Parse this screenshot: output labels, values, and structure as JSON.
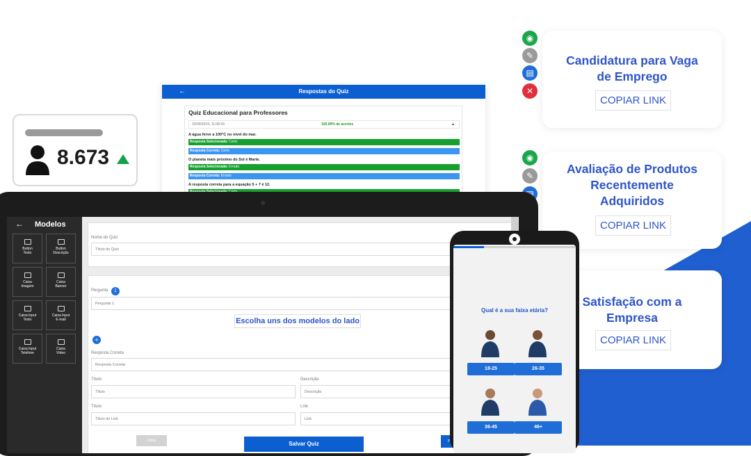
{
  "stat_card": {
    "value": "8.673",
    "trend": "up",
    "trend_color": "#15a04a"
  },
  "quiz_window": {
    "header": "Respostas do Quiz",
    "title": "Quiz Educacional para Professores",
    "timestamp": "25/09/2024, 11:08:43",
    "score": "100.00% de acertos",
    "questions": [
      {
        "text": "A água ferve a 100°C no nível do mar.",
        "selected_label": "Resposta Selecionada:",
        "selected": "Certo",
        "correct_label": "Resposta Correta:",
        "correct": "Certo"
      },
      {
        "text": "O planeta mais próximo do Sol é Marte.",
        "selected_label": "Resposta Selecionada:",
        "selected": "Errado",
        "correct_label": "Resposta Correta:",
        "correct": "Errado"
      },
      {
        "text": "A resposta correta para a equação 5 + 7 é 12.",
        "selected_label": "Resposta Selecionada:",
        "selected": "Certo"
      }
    ]
  },
  "cards": [
    {
      "title_line1": "Candidatura para Vaga",
      "title_line2": "de Emprego",
      "link": "COPIAR LINK"
    },
    {
      "title_line1": "Avaliação de Produtos",
      "title_line2": "Recentemente",
      "title_line3": "Adquiridos",
      "link": "COPIAR LINK"
    },
    {
      "title_line1": "Satisfação com a",
      "title_line2": "Empresa",
      "link": "COPIAR LINK"
    }
  ],
  "editor": {
    "sidebar_title": "Modelos",
    "tiles": [
      {
        "label1": "Button",
        "label2": "Texto"
      },
      {
        "label1": "Button",
        "label2": "Descrição"
      },
      {
        "label1": "Caixa",
        "label2": "Imagem"
      },
      {
        "label1": "Caixa",
        "label2": "Banner"
      },
      {
        "label1": "Caixa Input",
        "label2": "Texto"
      },
      {
        "label1": "Caixa Input",
        "label2": "E-mail"
      },
      {
        "label1": "Caixa Input",
        "label2": "Telefone"
      },
      {
        "label1": "Caixa",
        "label2": "Vídeo"
      }
    ],
    "quiz_name_label": "Nome do Quiz",
    "quiz_name_placeholder": "Título do Quiz",
    "question_label": "Pergunta",
    "question_number": "1",
    "question_value": "Pergunta 1",
    "choose_prompt": "Escolha uns dos modelos do lado",
    "plus": "+",
    "correct_label": "Resposta Correta",
    "correct_placeholder": "Resposta Correta",
    "title_label": "Título",
    "title_placeholder": "Título",
    "description_label": "Descrição",
    "description_placeholder": "Descrição",
    "title2_label": "Título",
    "title2_placeholder": "Título do Link",
    "link_label": "Link",
    "link_placeholder": "Link",
    "back_button": "Voltar",
    "save_button": "Salvar Quiz",
    "next_button": "Pró"
  },
  "phone": {
    "progress": 0.25,
    "question": "Qual é a sua faixa etária?",
    "options": [
      "18-25",
      "26-35",
      "36-45",
      "46+"
    ]
  },
  "colors": {
    "brand_blue": "#0c5fd1",
    "title_blue": "#2f55c8",
    "green": "#17a02f",
    "light_blue": "#3d95f2"
  }
}
